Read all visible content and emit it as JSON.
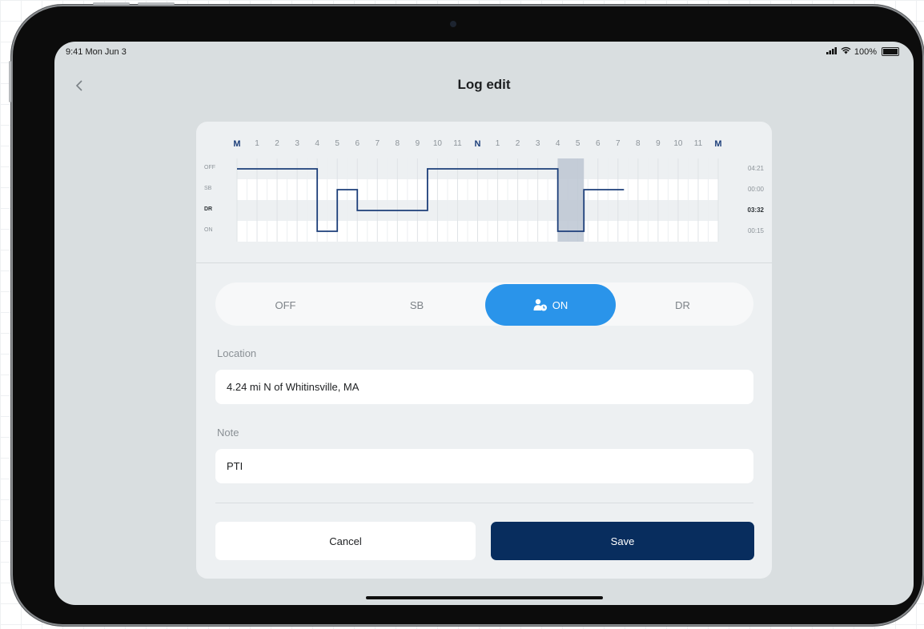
{
  "status_bar": {
    "time": "9:41 Mon Jun 3",
    "battery": "100%"
  },
  "header": {
    "back_icon": "chevron-left-icon",
    "title": "Log edit"
  },
  "chart_data": {
    "type": "line",
    "x_ticks": [
      "M",
      "1",
      "2",
      "3",
      "4",
      "5",
      "6",
      "7",
      "8",
      "9",
      "10",
      "11",
      "N",
      "1",
      "2",
      "3",
      "4",
      "5",
      "6",
      "7",
      "8",
      "9",
      "10",
      "11",
      "M"
    ],
    "y_categories": [
      "OFF",
      "SB",
      "DR",
      "ON"
    ],
    "totals": [
      "04:21",
      "00:00",
      "03:32",
      "00:15"
    ],
    "highlighted_total_index": 2,
    "segments": [
      {
        "status": "OFF",
        "start": 0,
        "end": 4
      },
      {
        "status": "ON",
        "start": 4,
        "end": 5
      },
      {
        "status": "SB",
        "start": 5,
        "end": 6
      },
      {
        "status": "DR",
        "start": 6,
        "end": 9.5
      },
      {
        "status": "OFF",
        "start": 9.5,
        "end": 16
      },
      {
        "status": "ON",
        "start": 16,
        "end": 17.3
      },
      {
        "status": "SB",
        "start": 17.3,
        "end": 19.3
      }
    ],
    "highlight_range": [
      16,
      17.3
    ],
    "line_color": "#1d3f7a",
    "highlight_color": "#bcc5d2"
  },
  "duty_toggle": {
    "options": [
      "OFF",
      "SB",
      "ON",
      "DR"
    ],
    "selected": "ON",
    "selected_icon": "user-clock-icon"
  },
  "location": {
    "label": "Location",
    "value": "4.24 mi N of Whitinsville, MA"
  },
  "note": {
    "label": "Note",
    "value": "PTI"
  },
  "actions": {
    "cancel": "Cancel",
    "save": "Save"
  },
  "colors": {
    "accent": "#2a94ea",
    "primary": "#082d5e"
  }
}
